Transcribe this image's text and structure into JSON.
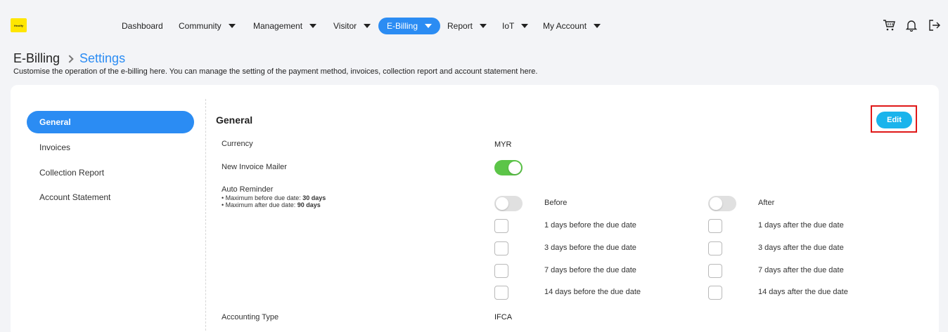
{
  "brand": {
    "logo_text": "Hextify"
  },
  "nav": [
    {
      "label": "Dashboard",
      "dropdown": false,
      "active": false
    },
    {
      "label": "Community",
      "dropdown": true,
      "active": false
    },
    {
      "label": "Management",
      "dropdown": true,
      "active": false
    },
    {
      "label": "Visitor",
      "dropdown": true,
      "active": false
    },
    {
      "label": "E-Billing",
      "dropdown": true,
      "active": true
    },
    {
      "label": "Report",
      "dropdown": true,
      "active": false
    },
    {
      "label": "IoT",
      "dropdown": true,
      "active": false
    },
    {
      "label": "My Account",
      "dropdown": true,
      "active": false
    }
  ],
  "top_icons": [
    "cart-icon",
    "bell-icon",
    "logout-icon"
  ],
  "breadcrumb": {
    "parent": "E-Billing",
    "current": "Settings"
  },
  "description": "Customise the operation of the e-billing here. You can manage the setting of the payment method, invoices, collection report and account statement here.",
  "sidebar": {
    "items": [
      {
        "label": "General",
        "active": true
      },
      {
        "label": "Invoices",
        "active": false
      },
      {
        "label": "Collection Report",
        "active": false
      },
      {
        "label": "Account Statement",
        "active": false
      }
    ]
  },
  "general": {
    "title": "General",
    "edit_label": "Edit",
    "currency_label": "Currency",
    "currency_value": "MYR",
    "mailer_label": "New Invoice Mailer",
    "mailer_on": true,
    "reminder_label": "Auto Reminder",
    "reminder_note_before_prefix": "• Maximum before due date: ",
    "reminder_note_before_value": "30 days",
    "reminder_note_after_prefix": "• Maximum after due date: ",
    "reminder_note_after_value": "90 days",
    "before_label": "Before",
    "after_label": "After",
    "before_on": false,
    "after_on": false,
    "before_options": [
      "1 days before the due date",
      "3 days before the due date",
      "7 days before the due date",
      "14 days before the due date"
    ],
    "after_options": [
      "1 days after the due date",
      "3 days after the due date",
      "7 days after the due date",
      "14 days after the due date"
    ],
    "accounting_label": "Accounting Type",
    "accounting_value": "IFCA"
  },
  "colors": {
    "accent": "#2b8cf3",
    "edit": "#1ab4ec",
    "toggle_on": "#5cc548",
    "highlight": "#e01818"
  }
}
